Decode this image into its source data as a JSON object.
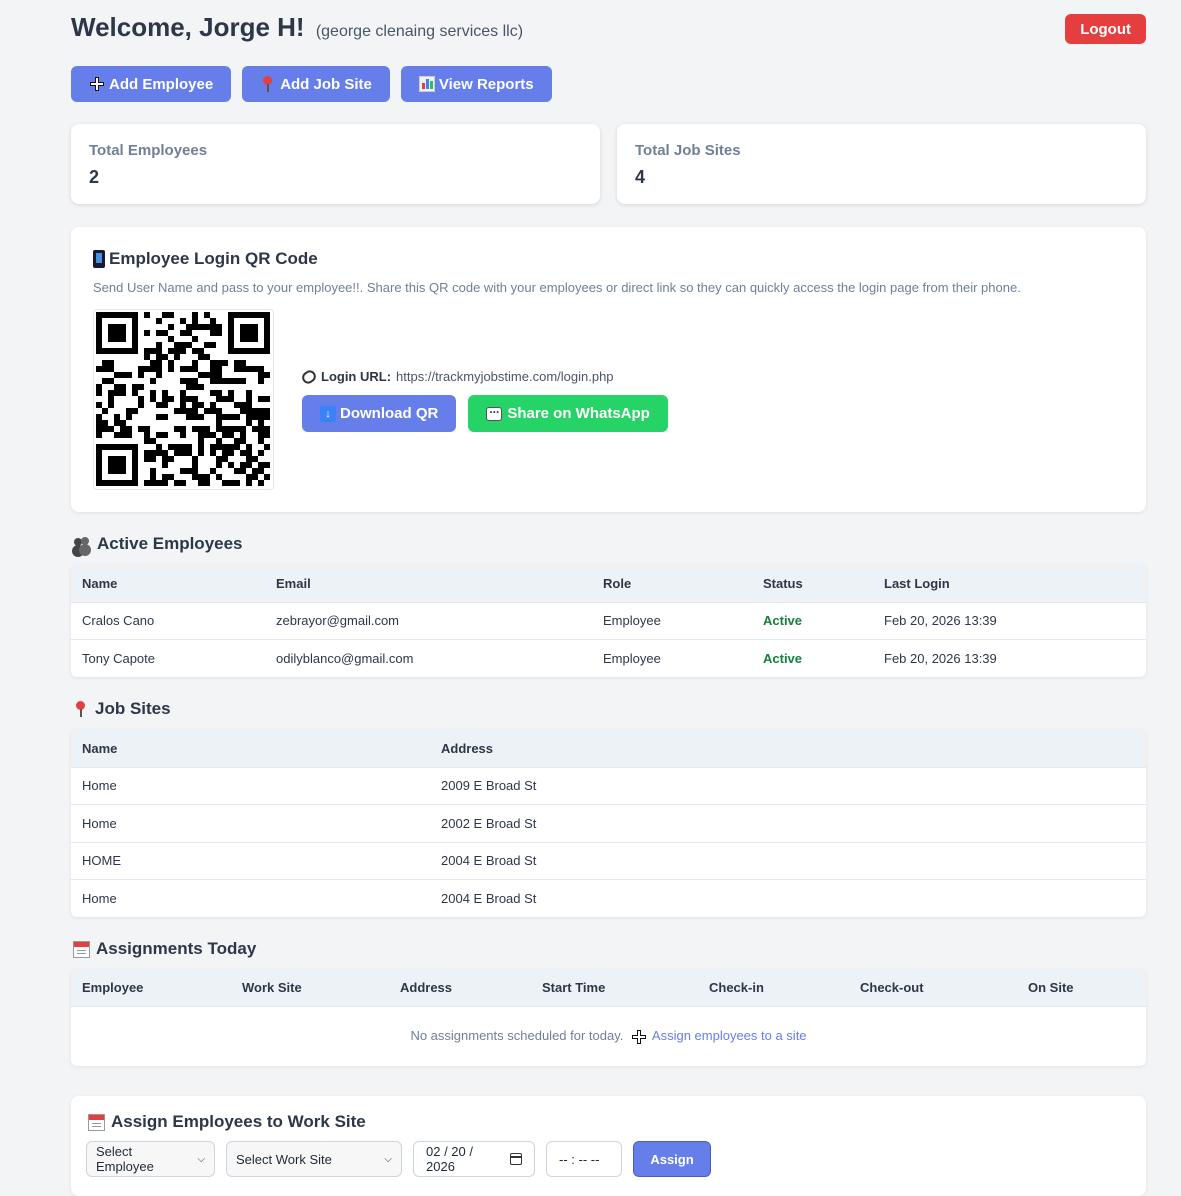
{
  "header": {
    "welcome": "Welcome, Jorge H!",
    "company": "(george clenaing services llc)",
    "logout_label": "Logout"
  },
  "actions": {
    "add_employee": "Add Employee",
    "add_job_site": "Add Job Site",
    "view_reports": "View Reports"
  },
  "stats": {
    "employees_label": "Total Employees",
    "employees_value": "2",
    "sites_label": "Total Job Sites",
    "sites_value": "4"
  },
  "qr": {
    "title": "Employee Login QR Code",
    "description": "Send User Name and pass to your employee!!. Share this QR code with your employees or direct link so they can quickly access the login page from their phone.",
    "url_label": "Login URL:",
    "url": "https://trackmyjobstime.com/login.php",
    "download_label": "Download QR",
    "whatsapp_label": "Share on WhatsApp"
  },
  "employees": {
    "title": "Active Employees",
    "columns": [
      "Name",
      "Email",
      "Role",
      "Status",
      "Last Login"
    ],
    "rows": [
      {
        "name": "Cralos Cano",
        "email": "zebrayor@gmail.com",
        "role": "Employee",
        "status": "Active",
        "last_login": "Feb 20, 2026 13:39"
      },
      {
        "name": "Tony Capote",
        "email": "odilyblanco@gmail.com",
        "role": "Employee",
        "status": "Active",
        "last_login": "Feb 20, 2026 13:39"
      }
    ]
  },
  "job_sites": {
    "title": "Job Sites",
    "columns": [
      "Name",
      "Address"
    ],
    "rows": [
      {
        "name": "Home",
        "address": "2009 E Broad St"
      },
      {
        "name": "Home",
        "address": "2002 E Broad St"
      },
      {
        "name": "HOME",
        "address": "2004 E Broad St"
      },
      {
        "name": "Home",
        "address": "2004 E Broad St"
      }
    ]
  },
  "assignments": {
    "title": "Assignments Today",
    "columns": [
      "Employee",
      "Work Site",
      "Address",
      "Start Time",
      "Check-in",
      "Check-out",
      "On Site"
    ],
    "empty_text": "No assignments scheduled for today.",
    "empty_link": "Assign employees to a site"
  },
  "assign_form": {
    "title": "Assign Employees to Work Site",
    "employee_select": "Select Employee",
    "site_select": "Select Work Site",
    "date_value": "02 / 20 / 2026",
    "time_value": "-- : --  --",
    "assign_label": "Assign"
  },
  "colors": {
    "primary": "#667eea",
    "logout": "#e53e3e",
    "whatsapp": "#25d366",
    "active": "#15803d"
  }
}
